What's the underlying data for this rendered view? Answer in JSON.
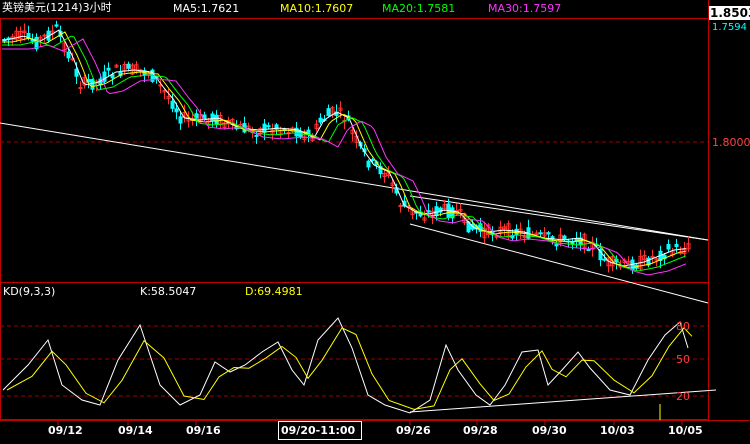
{
  "header": {
    "title": "英镑美元(1214)3小时",
    "ma5": "MA5:1.7621",
    "ma10": "MA10:1.7607",
    "ma20": "MA20:1.7581",
    "ma30": "MA30:1.7597"
  },
  "price_panel": {
    "current_price": "1.8503",
    "last_price": "1.7594",
    "level_label": "1.8000"
  },
  "kd_panel": {
    "title": "KD(9,3,3)",
    "k_text": "K:58.5047",
    "d_text": "D:69.4981",
    "levels": [
      "80",
      "50",
      "20"
    ]
  },
  "crosshair_label": "09/20-11:00",
  "colors": {
    "background": "#000000",
    "bull_candle": "#ff3030",
    "bear_candle": "#00ffff",
    "ma5": "#ffffff",
    "ma10": "#ffff00",
    "ma20": "#00ff00",
    "ma30": "#ff33ff",
    "grid": "#a00000",
    "frame": "#c00000"
  },
  "chart_data": [
    {
      "type": "candlestick",
      "title": "英镑美元(1214)3小时",
      "x_tick_labels": [
        "09/12",
        "09/14",
        "09/16",
        "09/20-11:00",
        "09/26",
        "09/28",
        "09/30",
        "10/03",
        "10/05"
      ],
      "y_tick_labels": [
        "1.8000"
      ],
      "ylim": [
        1.68,
        1.8503
      ],
      "series": [
        {
          "name": "MA5",
          "value": 1.7621
        },
        {
          "name": "MA10",
          "value": 1.7607
        },
        {
          "name": "MA20",
          "value": 1.7581
        },
        {
          "name": "MA30",
          "value": 1.7597
        }
      ],
      "close_path": [
        {
          "x": "09/12",
          "y": 1.845
        },
        {
          "x": "09/13",
          "y": 1.815
        },
        {
          "x": "09/14",
          "y": 1.822
        },
        {
          "x": "09/15",
          "y": 1.811
        },
        {
          "x": "09/16",
          "y": 1.802
        },
        {
          "x": "09/19",
          "y": 1.806
        },
        {
          "x": "09/20",
          "y": 1.811
        },
        {
          "x": "09/21",
          "y": 1.799
        },
        {
          "x": "09/22",
          "y": 1.787
        },
        {
          "x": "09/26",
          "y": 1.773
        },
        {
          "x": "09/27",
          "y": 1.768
        },
        {
          "x": "09/28",
          "y": 1.765
        },
        {
          "x": "09/29",
          "y": 1.763
        },
        {
          "x": "09/30",
          "y": 1.763
        },
        {
          "x": "10/01",
          "y": 1.766
        },
        {
          "x": "10/03",
          "y": 1.756
        },
        {
          "x": "10/04",
          "y": 1.758
        },
        {
          "x": "10/05",
          "y": 1.762
        }
      ]
    },
    {
      "type": "line",
      "title": "KD(9,3,3)",
      "series": [
        {
          "name": "K",
          "last": 58.5047
        },
        {
          "name": "D",
          "last": 69.4981
        }
      ],
      "levels": [
        80,
        50,
        20
      ],
      "ylim": [
        0,
        100
      ]
    }
  ]
}
